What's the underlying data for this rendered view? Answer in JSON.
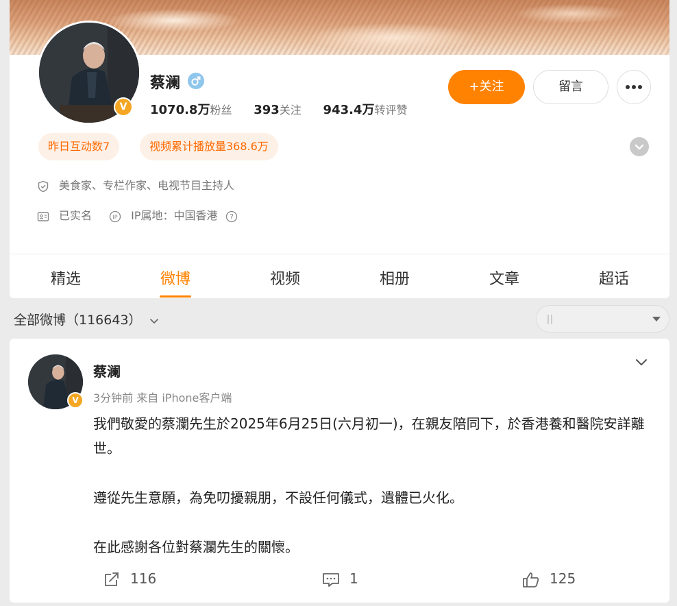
{
  "profile": {
    "name": "蔡澜",
    "stats": [
      {
        "value": "1070.8万",
        "label": "粉丝"
      },
      {
        "value": "393",
        "label": "关注"
      },
      {
        "value": "943.4万",
        "label": "转评赞"
      }
    ],
    "follow_label": "+关注",
    "message_label": "留言",
    "pills": [
      "昨日互动数7",
      "视频累计播放量368.6万"
    ],
    "bio": "美食家、专栏作家、电视节目主持人",
    "verified_label": "已实名",
    "ip_label": "IP属地：中国香港"
  },
  "tabs": [
    "精选",
    "微博",
    "视频",
    "相册",
    "文章",
    "超话"
  ],
  "active_tab": "微博",
  "filter": {
    "label": "全部微博（116643）"
  },
  "post": {
    "author": "蔡澜",
    "meta": "3分钟前  来自 iPhone客户端",
    "paragraphs": [
      "我們敬愛的蔡瀾先生於2025年6月25日(六月初一)，在親友陪同下，於香港養和醫院安詳離世。",
      "遵從先生意願，為免叨擾親朋，不設任何儀式，遺體已火化。",
      "在此感謝各位對蔡瀾先生的關懷。"
    ],
    "repost_count": "116",
    "comment_count": "1",
    "like_count": "125"
  },
  "colors": {
    "accent": "#ff8200",
    "pill_bg": "#fdf0e6",
    "verified_badge": "#f5a623"
  },
  "icons": [
    "shield-icon",
    "id-card-icon",
    "ip-icon",
    "help-icon",
    "repost-icon",
    "comment-icon",
    "like-icon",
    "chevron-down-icon",
    "more-icon",
    "male-icon"
  ]
}
